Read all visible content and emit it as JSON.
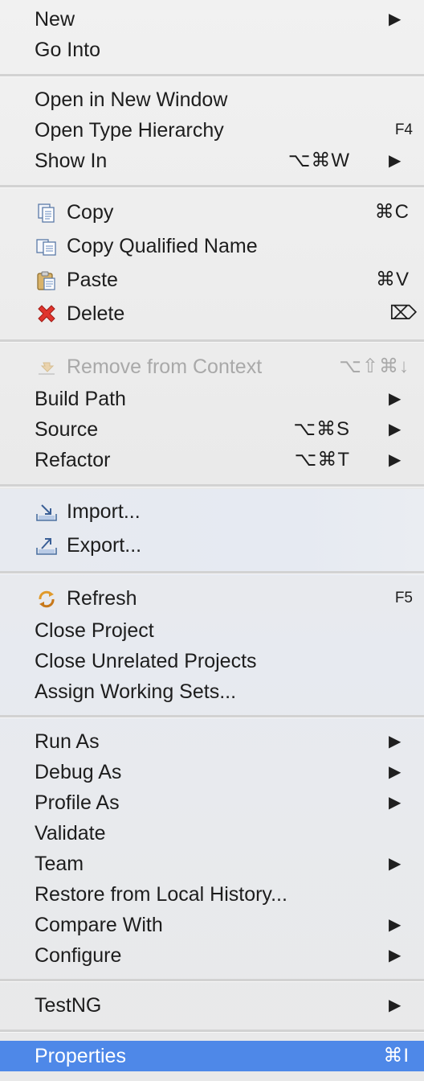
{
  "menu": {
    "groups": [
      [
        {
          "label": "New",
          "arrow": "▶"
        },
        {
          "label": "Go Into"
        }
      ],
      [
        {
          "label": "Open in New Window"
        },
        {
          "label": "Open Type Hierarchy",
          "fkey": "F4"
        },
        {
          "label": "Show In",
          "shortcut": "⌥⌘W",
          "arrow": "▶"
        }
      ],
      [
        {
          "label": "Copy",
          "shortcut": "⌘C",
          "icon": "copy-icon"
        },
        {
          "label": "Copy Qualified Name",
          "icon": "copy-qualified-name-icon"
        },
        {
          "label": "Paste",
          "shortcut": "⌘V",
          "icon": "paste-icon"
        },
        {
          "label": "Delete",
          "shortcut": "⌦",
          "icon": "delete-icon"
        }
      ],
      [
        {
          "label": "Remove from Context",
          "shortcut": "⌥⇧⌘↓",
          "icon": "remove-from-context-icon",
          "disabled": true
        },
        {
          "label": "Build Path",
          "arrow": "▶"
        },
        {
          "label": "Source",
          "shortcut": "⌥⌘S",
          "arrow": "▶"
        },
        {
          "label": "Refactor",
          "shortcut": "⌥⌘T",
          "arrow": "▶"
        }
      ],
      [
        {
          "label": "Import...",
          "icon": "import-icon"
        },
        {
          "label": "Export...",
          "icon": "export-icon"
        }
      ],
      [
        {
          "label": "Refresh",
          "fkey": "F5",
          "icon": "refresh-icon"
        },
        {
          "label": "Close Project"
        },
        {
          "label": "Close Unrelated Projects"
        },
        {
          "label": "Assign Working Sets..."
        }
      ],
      [
        {
          "label": "Run As",
          "arrow": "▶"
        },
        {
          "label": "Debug As",
          "arrow": "▶"
        },
        {
          "label": "Profile As",
          "arrow": "▶"
        },
        {
          "label": "Validate"
        },
        {
          "label": "Team",
          "arrow": "▶"
        },
        {
          "label": "Restore from Local History..."
        },
        {
          "label": "Compare With",
          "arrow": "▶"
        },
        {
          "label": "Configure",
          "arrow": "▶"
        }
      ],
      [
        {
          "label": "TestNG",
          "arrow": "▶"
        }
      ],
      [
        {
          "label": "Properties",
          "shortcut": "⌘I",
          "selected": true
        }
      ]
    ]
  },
  "colors": {
    "selection": "#4e88e8",
    "separator": "#d2d2d2",
    "disabled_text": "#a9a9a9"
  }
}
